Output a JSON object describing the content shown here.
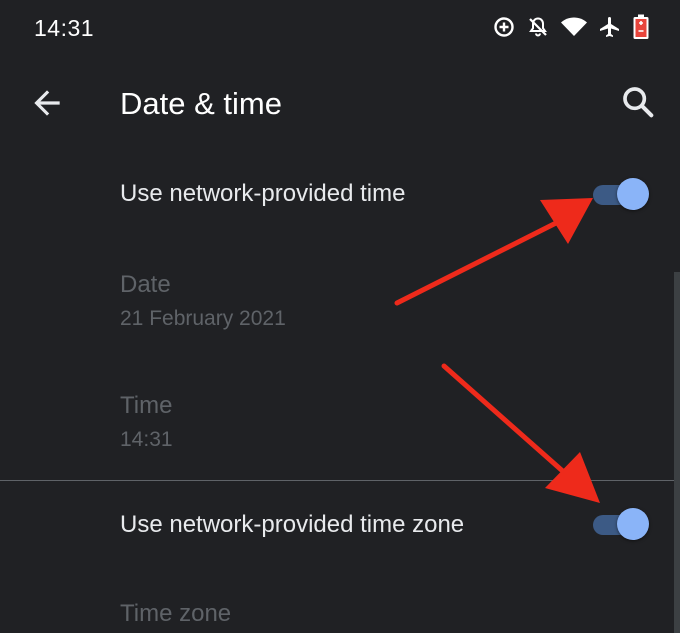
{
  "status_bar": {
    "time": "14:31",
    "icons": [
      "data-saver-icon",
      "notifications-off-icon",
      "wifi-icon",
      "airplane-icon",
      "battery-saver-icon"
    ]
  },
  "app_bar": {
    "title": "Date & time",
    "back_icon": "arrow-back-icon",
    "search_icon": "search-icon"
  },
  "settings": {
    "network_time": {
      "label": "Use network-provided time",
      "enabled": true
    },
    "date": {
      "label": "Date",
      "value": "21 February 2021"
    },
    "time": {
      "label": "Time",
      "value": "14:31"
    },
    "network_time_zone": {
      "label": "Use network-provided time zone",
      "enabled": true
    },
    "time_zone": {
      "label": "Time zone"
    }
  },
  "colors": {
    "background": "#202124",
    "toggle_thumb": "#8ab4f8",
    "toggle_track": "#3c5a85",
    "annotation_arrow": "#ee2a1b",
    "disabled_text": "#5f6368"
  }
}
